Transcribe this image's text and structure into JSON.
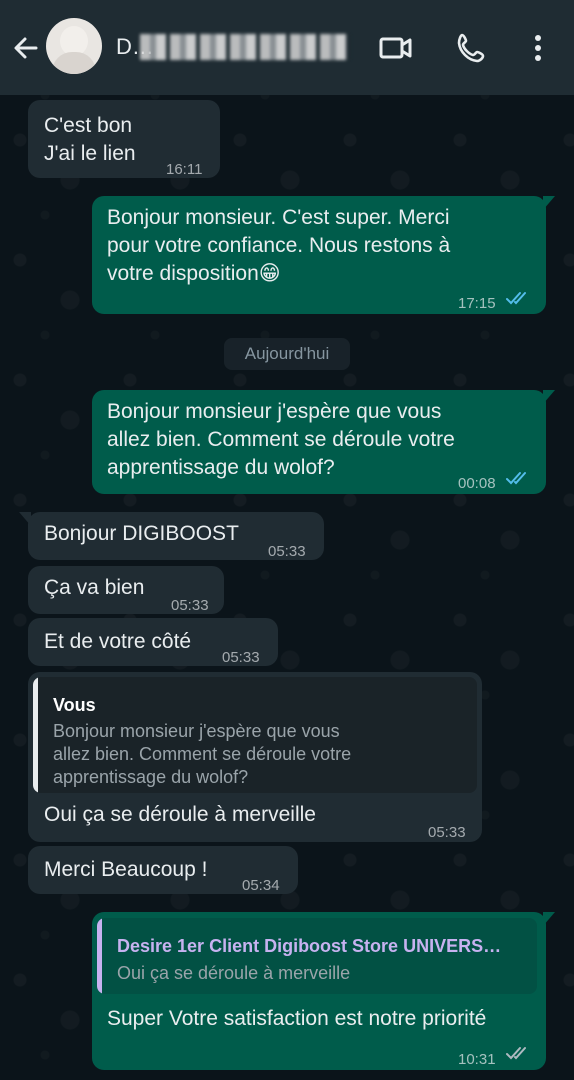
{
  "colors": {
    "header_bg": "#1f2c33",
    "chat_bg": "#0b141a",
    "incoming_bubble": "#202c33",
    "outgoing_bubble": "#005c4b",
    "read_ticks": "#53bdeb",
    "quote_author_in": "#ffffff",
    "quote_author_out": "#c7b2f0"
  },
  "header": {
    "contact_name": "D…",
    "icons": [
      "back-arrow-icon",
      "video-call-icon",
      "voice-call-icon",
      "more-options-icon"
    ]
  },
  "messages": [
    {
      "dir": "in",
      "text": "C'est bon\nJ'ai le lien",
      "time": "16:11"
    },
    {
      "dir": "out",
      "text": "Bonjour monsieur. C'est super. Merci\npour votre confiance. Nous restons à\nvotre disposition😁",
      "time": "17:15",
      "status": "read"
    },
    {
      "dir": "out",
      "text": "Bonjour monsieur j'espère que vous\nallez bien. Comment se déroule votre\napprentissage du wolof?",
      "time": "00:08",
      "status": "read"
    },
    {
      "dir": "in",
      "text": "Bonjour DIGIBOOST",
      "time": "05:33"
    },
    {
      "dir": "in",
      "text": "Ça va bien",
      "time": "05:33"
    },
    {
      "dir": "in",
      "text": "Et de votre côté",
      "time": "05:33"
    },
    {
      "dir": "in",
      "text": "Oui ça se déroule à merveille",
      "time": "05:33",
      "quote": {
        "author": "Vous",
        "text": "Bonjour monsieur j'espère que vous\nallez bien. Comment se déroule votre\napprentissage du wolof?"
      }
    },
    {
      "dir": "in",
      "text": "Merci Beaucoup !",
      "time": "05:34"
    },
    {
      "dir": "out",
      "text": "Super Votre satisfaction est notre priorité",
      "time": "10:31",
      "status": "delivered",
      "quote": {
        "author": "Desire 1er Client Digiboost Store UNIVERS…",
        "text": "Oui ça se déroule à merveille"
      }
    }
  ],
  "day_separator": "Aujourd'hui"
}
